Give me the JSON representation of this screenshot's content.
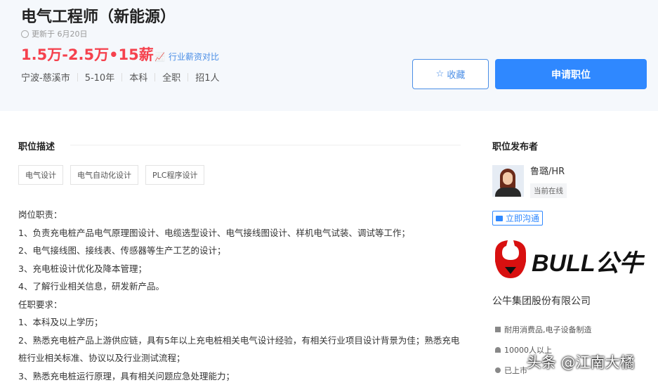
{
  "job": {
    "title": "电气工程师（新能源）",
    "updated": "更新于 6月20日",
    "salary": "1.5万-2.5万•15薪",
    "compare": "行业薪资对比",
    "meta": [
      "宁波-慈溪市",
      "5-10年",
      "本科",
      "全职",
      "招1人"
    ],
    "favorite": "收藏",
    "apply": "申请职位"
  },
  "description": {
    "heading": "职位描述",
    "tags": [
      "电气设计",
      "电气自动化设计",
      "PLC程序设计"
    ],
    "lines": [
      "岗位职责：",
      "1、负责充电桩产品电气原理图设计、电缆选型设计、电气接线图设计、样机电气试装、调试等工作；",
      "2、电气接线图、接线表、传感器等生产工艺的设计；",
      "3、充电桩设计优化及降本管理；",
      "4、了解行业相关信息，研发新产品。",
      "任职要求：",
      "1、本科及以上学历；",
      "2、熟悉充电桩产品上游供应链，具有5年以上充电桩相关电气设计经验，有相关行业项目设计背景为佳；熟悉充电桩行业相关标准、协议以及行业测试流程；",
      "3、熟悉充电桩运行原理，具有相关问题应急处理能力；"
    ]
  },
  "publisher": {
    "heading": "职位发布者",
    "name": "鲁璐/HR",
    "status": "当前在线",
    "chat": "立即沟通"
  },
  "company": {
    "logo_text": "BULL公牛",
    "name": "公牛集团股份有限公司",
    "industry": "耐用消费品,电子设备制造",
    "size": "10000人以上",
    "stage": "已上市"
  },
  "watermark": "头条 @江南大橘"
}
